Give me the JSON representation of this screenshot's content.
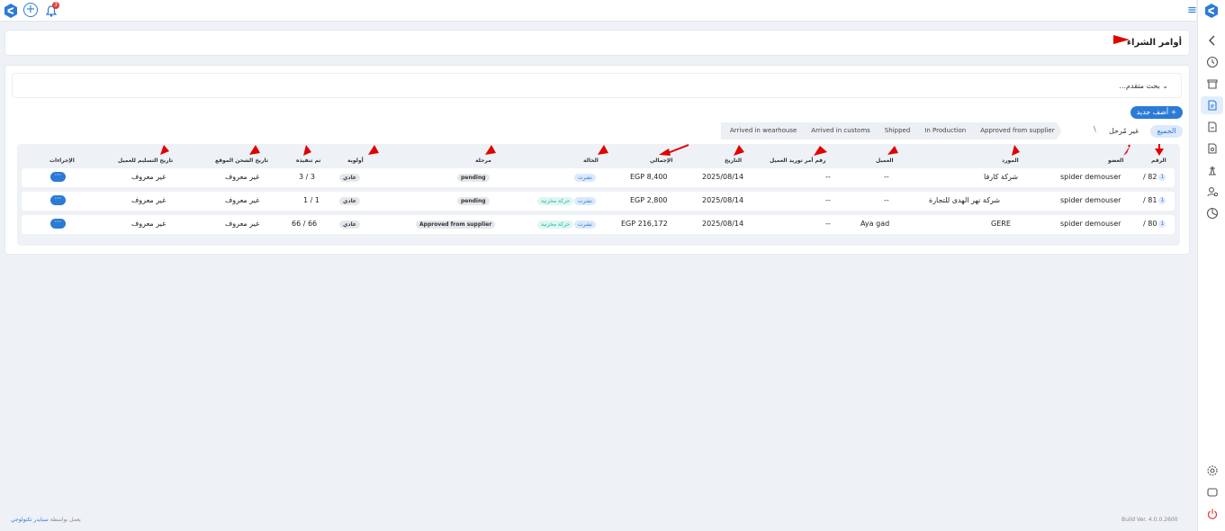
{
  "topbar": {
    "notification_count": "3",
    "menu_icon": "hamburger-icon"
  },
  "page": {
    "title": "أوامر الشراء"
  },
  "search": {
    "advanced_label": "بحث متقدم..."
  },
  "actions": {
    "add_new": "+ أضف جديد"
  },
  "filters": {
    "all": "الجميع",
    "closed": "غير مُرحل",
    "separator": "\\"
  },
  "stages": [
    "Arrived in wearhouse",
    "Arrived in customs",
    "Shipped",
    "In Production",
    "Approved from supplier"
  ],
  "table": {
    "headers": {
      "number": "الرقم",
      "member": "العضو",
      "supplier": "المورد",
      "client": "العميل",
      "client_po": "رقم أمر توريد العميل",
      "date": "التاريخ",
      "total": "الإجمالي",
      "status": "الحالة",
      "stage": "مرحلة",
      "priority": "أولوية",
      "executed": "تم تنفيذه",
      "site_ship_date": "تاريخ الشحن الموقع",
      "client_delivery_date": "تاريخ التسليم للعميل",
      "actions": "الإجراءات"
    },
    "rows": [
      {
        "number": "82 /",
        "badge": "1",
        "member": "spider demouser",
        "supplier": "شركة كارفا",
        "client": "--",
        "client_po": "--",
        "date": "2025/08/14",
        "total": "EGP 8,400",
        "status": "نشرت",
        "status2": "",
        "stage": "pending",
        "priority": "عادي",
        "executed": "3 / 3",
        "site_ship_date": "غير معروف",
        "client_delivery_date": "غير معروف",
        "action_label": "···"
      },
      {
        "number": "81 /",
        "badge": "1",
        "member": "spider demouser",
        "supplier": "شركة نهر الهدى للتجارة",
        "client": "--",
        "client_po": "--",
        "date": "2025/08/14",
        "total": "EGP 2,800",
        "status": "نشرت",
        "status2": "حركة مخزنية",
        "stage": "pending",
        "priority": "عادي",
        "executed": "1 / 1",
        "site_ship_date": "غير معروف",
        "client_delivery_date": "غير معروف",
        "action_label": "···"
      },
      {
        "number": "80 /",
        "badge": "1",
        "member": "spider demouser",
        "supplier": "GERE",
        "client": "Aya gad",
        "client_po": "--",
        "date": "2025/08/14",
        "total": "EGP 216,172",
        "status": "نشرت",
        "status2": "حركة مخزنية",
        "stage": "Approved from supplier",
        "priority": "عادي",
        "executed": "66 / 66",
        "site_ship_date": "غير معروف",
        "client_delivery_date": "غير معروف",
        "action_label": "···"
      }
    ]
  },
  "footer": {
    "powered_prefix": "يعمل بواسطة",
    "powered_link": "سبايدر تكنولوجي",
    "build": "Build Ver. 4.0.0.2600"
  },
  "colors": {
    "accent": "#2b7bd6",
    "annotation_arrow": "#e00000",
    "teal": "#1fb7a1",
    "badge_red": "#e23b3b"
  }
}
